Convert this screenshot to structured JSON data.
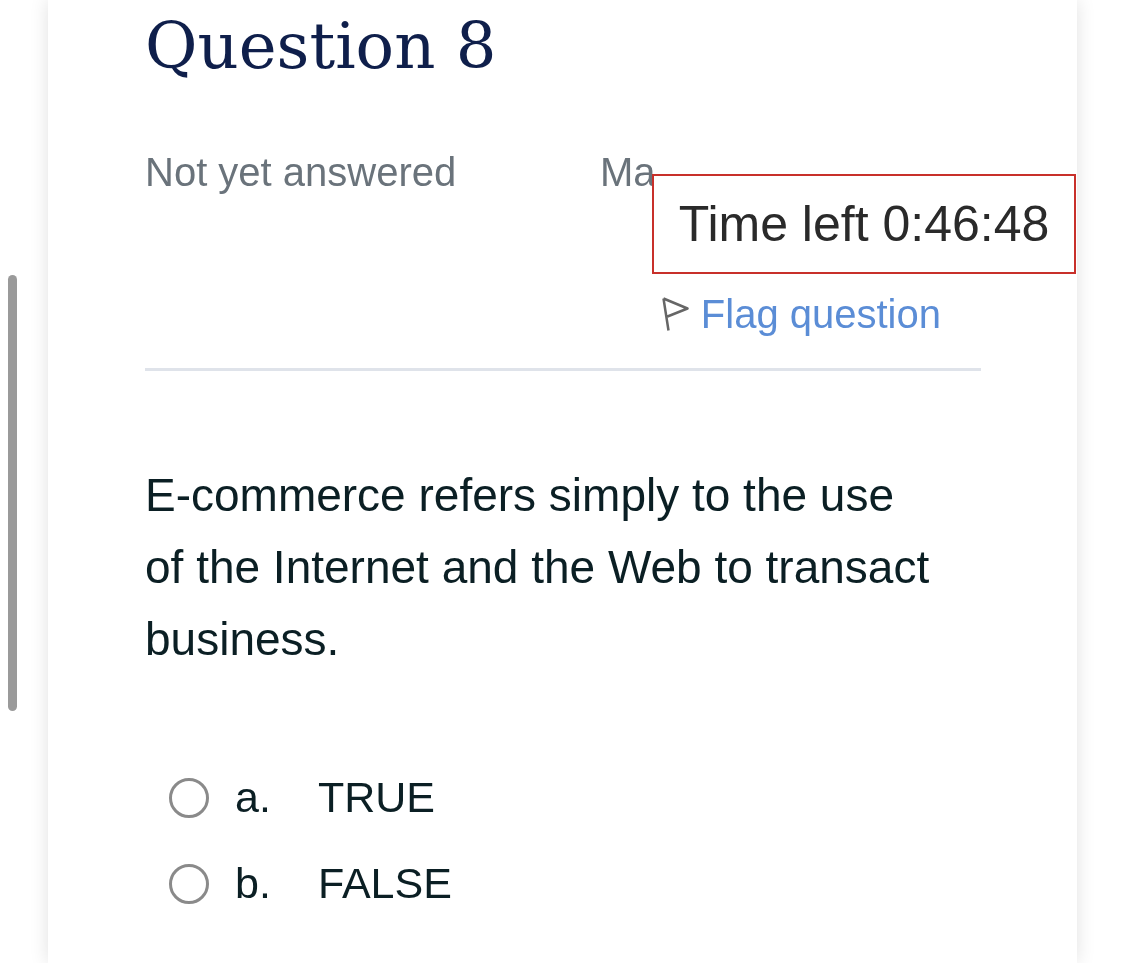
{
  "question": {
    "title": "Question 8",
    "status": "Not yet answered",
    "marks": "Ma",
    "flag": {
      "label": "Flag question",
      "flagged": false
    },
    "text": "E-commerce refers simply to the use of the Internet and the Web to transact business.",
    "options": [
      {
        "letter": "a.",
        "label": "TRUE",
        "selected": false
      },
      {
        "letter": "b.",
        "label": "FALSE",
        "selected": false
      }
    ]
  },
  "timer": {
    "text": "Time left 0:46:48"
  }
}
